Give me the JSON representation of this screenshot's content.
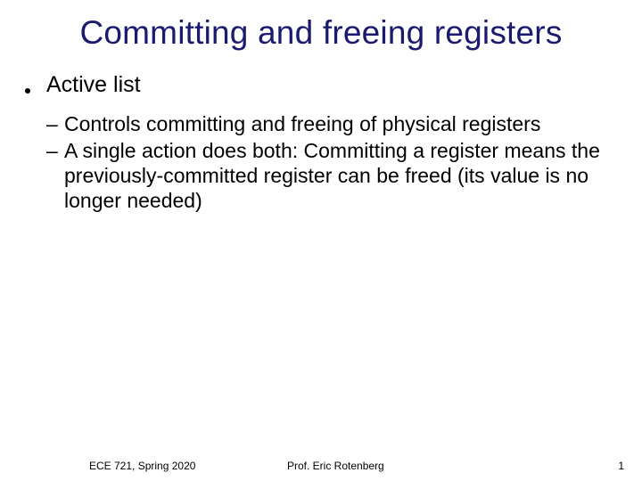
{
  "title": "Committing and freeing registers",
  "bullets": {
    "b1": {
      "text": "Active list"
    },
    "sub1": {
      "marker": "–",
      "text": "Controls committing and freeing of physical registers"
    },
    "sub2": {
      "marker": "–",
      "text": "A single action does both: Committing a register means the previously-committed register can be freed (its value is no longer needed)"
    }
  },
  "footer": {
    "left": "ECE 721, Spring 2020",
    "center": "Prof. Eric Rotenberg",
    "right": "1"
  }
}
